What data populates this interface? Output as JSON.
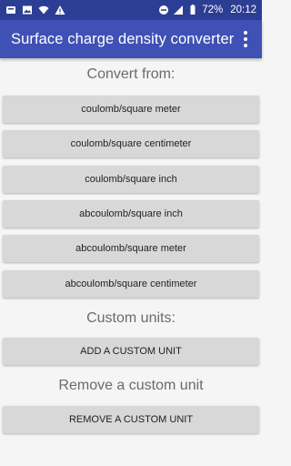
{
  "status_bar": {
    "battery": "72%",
    "time": "20:12",
    "signal_label": "H",
    "icons": [
      "notification-icon",
      "image-icon",
      "wifi-icon",
      "warning-icon",
      "dnd-icon",
      "signal-icon",
      "battery-icon"
    ]
  },
  "app_bar": {
    "title": "Surface charge density converter"
  },
  "convert_from": {
    "heading": "Convert from:",
    "units": [
      "coulomb/square meter",
      "coulomb/square centimeter",
      "coulomb/square inch",
      "abcoulomb/square inch",
      "abcoulomb/square meter",
      "abcoulomb/square centimeter"
    ]
  },
  "custom_units": {
    "heading": "Custom units:",
    "add_label": "ADD A CUSTOM UNIT"
  },
  "remove_custom": {
    "heading": "Remove a custom unit",
    "remove_label": "REMOVE A CUSTOM UNIT"
  },
  "colors": {
    "status_bar": "#2c3e94",
    "app_bar": "#3f51b5",
    "background": "#f5f5f5",
    "button": "#d8d8d8"
  }
}
